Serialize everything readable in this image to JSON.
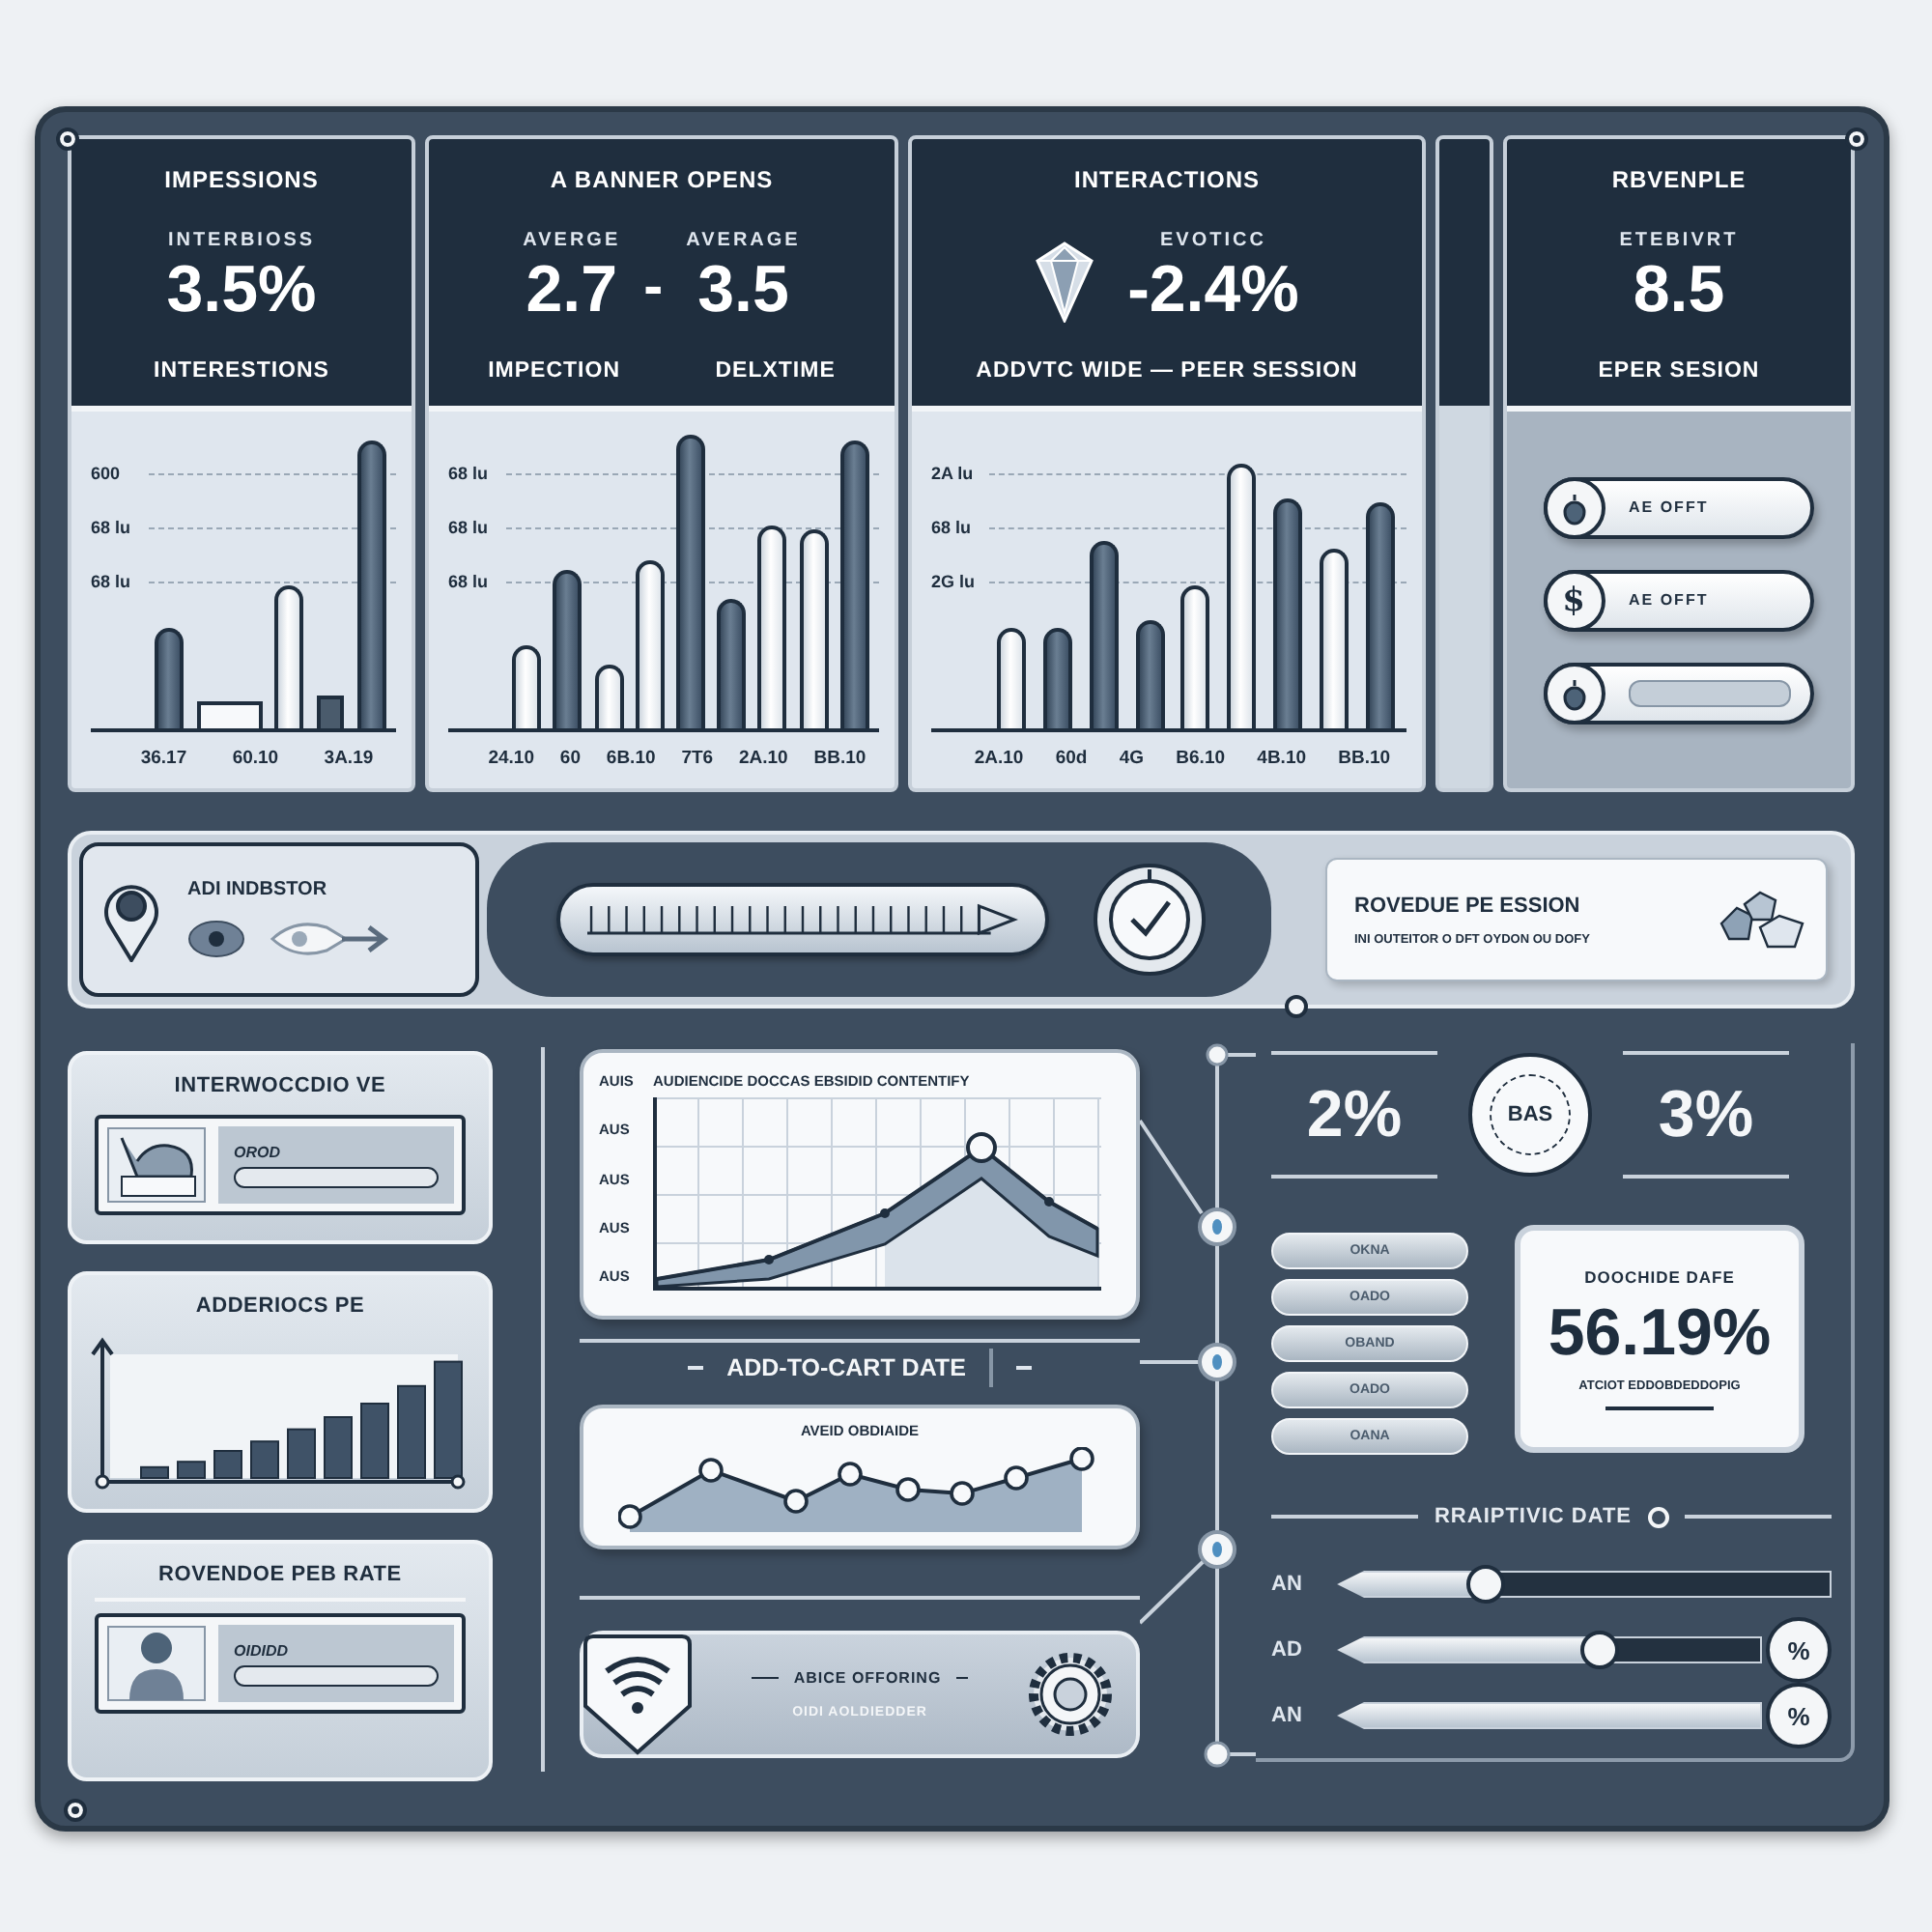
{
  "top_cards": [
    {
      "kind": "metric",
      "title": "IMPESSIONS",
      "subtitles": [
        "INTERBIOSS"
      ],
      "values": [
        "3.5%"
      ],
      "footers": [
        "INTERESTIONS"
      ],
      "chart": {
        "y_labels": [
          "600",
          "68 lu",
          "68 lu"
        ],
        "x_labels": [
          "36.17",
          "60.10",
          "3A.19"
        ]
      }
    },
    {
      "kind": "pair",
      "title": "A BANNER OPENS",
      "subtitles": [
        "AVERGE",
        "AVERAGE"
      ],
      "values": [
        "2.7",
        "3.5"
      ],
      "separator": "-",
      "footers": [
        "IMPECTION",
        "DELXTIME"
      ],
      "chart": {
        "y_labels": [
          "68 lu",
          "68 lu",
          "68 lu"
        ],
        "x_labels": [
          "24.10",
          "60",
          "6B.10",
          "7T6",
          "2A.10",
          "BB.10"
        ]
      }
    },
    {
      "kind": "icon_metric",
      "title": "INTERACTIONS",
      "subtitles": [
        "EVOTICC"
      ],
      "values": [
        "-2.4%"
      ],
      "footers": [
        "ADDVTC WIDE — PEER SESSION"
      ],
      "chart": {
        "y_labels": [
          "2A lu",
          "68 lu",
          "2G lu"
        ],
        "x_labels": [
          "2A.10",
          "60d",
          "4G",
          "B6.10",
          "4B.10",
          "BB.10"
        ]
      }
    },
    {
      "kind": "metric",
      "title": "RBVENPLE",
      "subtitles": [
        "ETEBIVRT"
      ],
      "values": [
        "8.5"
      ],
      "footers": [
        "EPER SESION"
      ],
      "toggles": [
        {
          "kind": "labeled",
          "label": "AE OFFT"
        },
        {
          "kind": "labeled",
          "symbol": "$",
          "label": "AE OFFT"
        },
        {
          "kind": "blank"
        }
      ]
    }
  ],
  "strip": {
    "label": "ADI INDBSTOR",
    "title": "ROVEDUE PE ESSION",
    "text": "INI OUTEITOR O DFT OYDON OU DOFY"
  },
  "side_cards": [
    {
      "kind": "image_field",
      "title": "INTERWOCCDIO VE",
      "field": "OROD"
    },
    {
      "kind": "bar_chart",
      "title": "ADDERIOCS PE"
    },
    {
      "kind": "profile_field",
      "title": "ROVENDOE PEB RATE",
      "field": "OIDIDD"
    }
  ],
  "trend_chart": {
    "title": "AUDIENCIDE DOCCAS EBSIDID CONTENTIFY",
    "y_labels": [
      "AUIS",
      "AUS",
      "AUS",
      "AUS",
      "AUS"
    ]
  },
  "section_label": "ADD-TO-CART DATE",
  "points_chart": {
    "title": "AVEID OBDIAIDE"
  },
  "offer": {
    "title": "ABICE OFFORING",
    "text": "OIDI AOLDIEDDER"
  },
  "stats": [
    {
      "kind": "value",
      "text": "2%"
    },
    {
      "kind": "badge",
      "text": "BAS"
    },
    {
      "kind": "value",
      "text": "3%"
    }
  ],
  "pills": [
    "OKNA",
    "OADO",
    "OBAND",
    "OADO",
    "OANA"
  ],
  "rate_card": {
    "title": "DOOCHIDE DAFE",
    "value": "56.19%",
    "caption": "ATCIOT EDDOBDEDDOPIG"
  },
  "sliders": {
    "title": "RRAIPTIVIC DATE",
    "rows": [
      {
        "label": "AN",
        "level": 0.3
      },
      {
        "label": "AD",
        "level": 0.62,
        "badge": "%"
      },
      {
        "label": "AN",
        "level": 1,
        "badge": "%"
      }
    ]
  }
}
